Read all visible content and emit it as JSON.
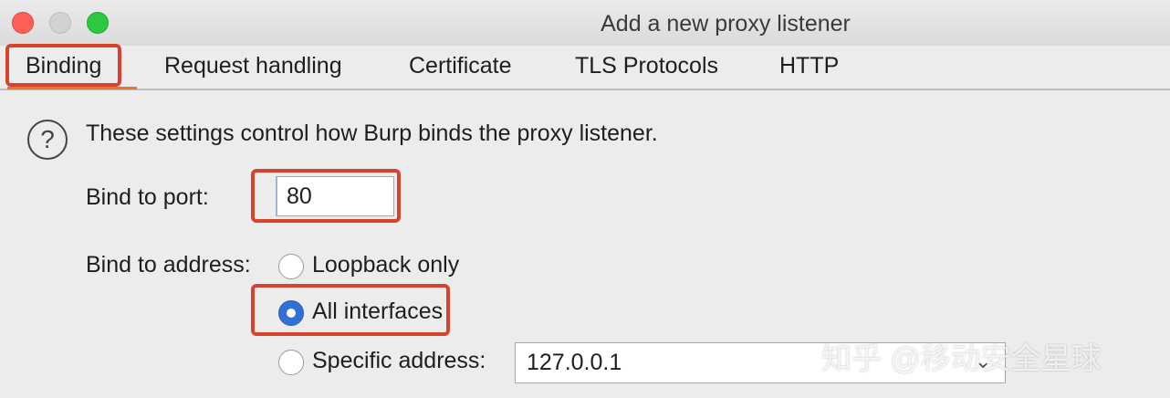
{
  "window": {
    "title": "Add a new proxy listener"
  },
  "tabs": [
    {
      "label": "Binding",
      "selected": true
    },
    {
      "label": "Request handling"
    },
    {
      "label": "Certificate"
    },
    {
      "label": "TLS Protocols"
    },
    {
      "label": "HTTP"
    }
  ],
  "binding": {
    "description": "These settings control how Burp binds the proxy listener.",
    "port_label": "Bind to port:",
    "port_value": "80",
    "address_label": "Bind to address:",
    "options": [
      {
        "label": "Loopback only",
        "selected": false
      },
      {
        "label": "All interfaces",
        "selected": true
      },
      {
        "label": "Specific address:",
        "selected": false
      }
    ],
    "specific_address_value": "127.0.0.1"
  },
  "icons": {
    "help": "help-icon",
    "dropdown": "chevron-down-icon"
  },
  "colors": {
    "accent": "#2f6fd6",
    "annotation": "#d8432f",
    "tab_underline": "#e8742e"
  },
  "watermark": "知乎 @移动安全星球"
}
